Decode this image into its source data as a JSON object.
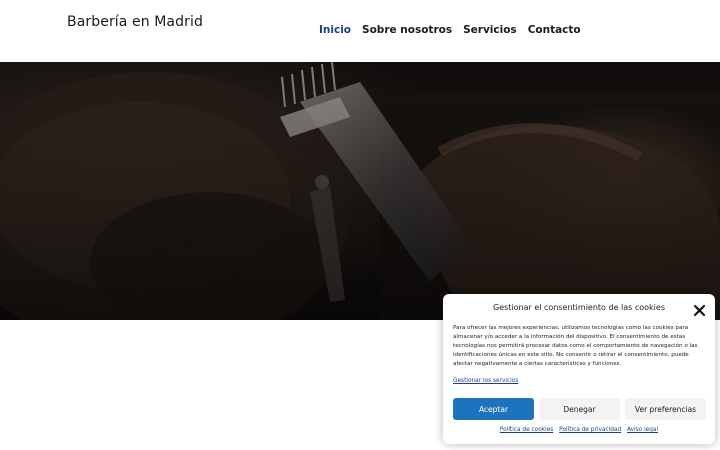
{
  "header": {
    "brand": "Barbería en Madrid",
    "nav": [
      {
        "label": "Inicio",
        "active": true
      },
      {
        "label": "Sobre nosotros",
        "active": false
      },
      {
        "label": "Servicios",
        "active": false
      },
      {
        "label": "Contacto",
        "active": false
      }
    ],
    "active_color": "#1e3f8f"
  },
  "hero": {
    "image": "barber-trimming-beard-with-clippers"
  },
  "cookie_banner": {
    "title": "Gestionar el consentimiento de las cookies",
    "close_icon": "close-icon",
    "body": "Para ofrecer las mejores experiencias, utilizamos tecnologías como las cookies para almacenar y/o acceder a la información del dispositivo. El consentimiento de estas tecnologías nos permitirá procesar datos como el comportamiento de navegación o las identificaciones únicas en este sitio. No consentir o retirar el consentimiento, puede afectar negativamente a ciertas características y funciones.",
    "services_link": "Gestionar los servicios",
    "buttons": {
      "accept": "Aceptar",
      "deny": "Denegar",
      "preferences": "Ver preferencias"
    },
    "accept_color": "#1e73be",
    "footer_links": {
      "cookies": "Política de cookies",
      "privacy": "Política de privacidad",
      "legal": "Aviso legal"
    }
  }
}
